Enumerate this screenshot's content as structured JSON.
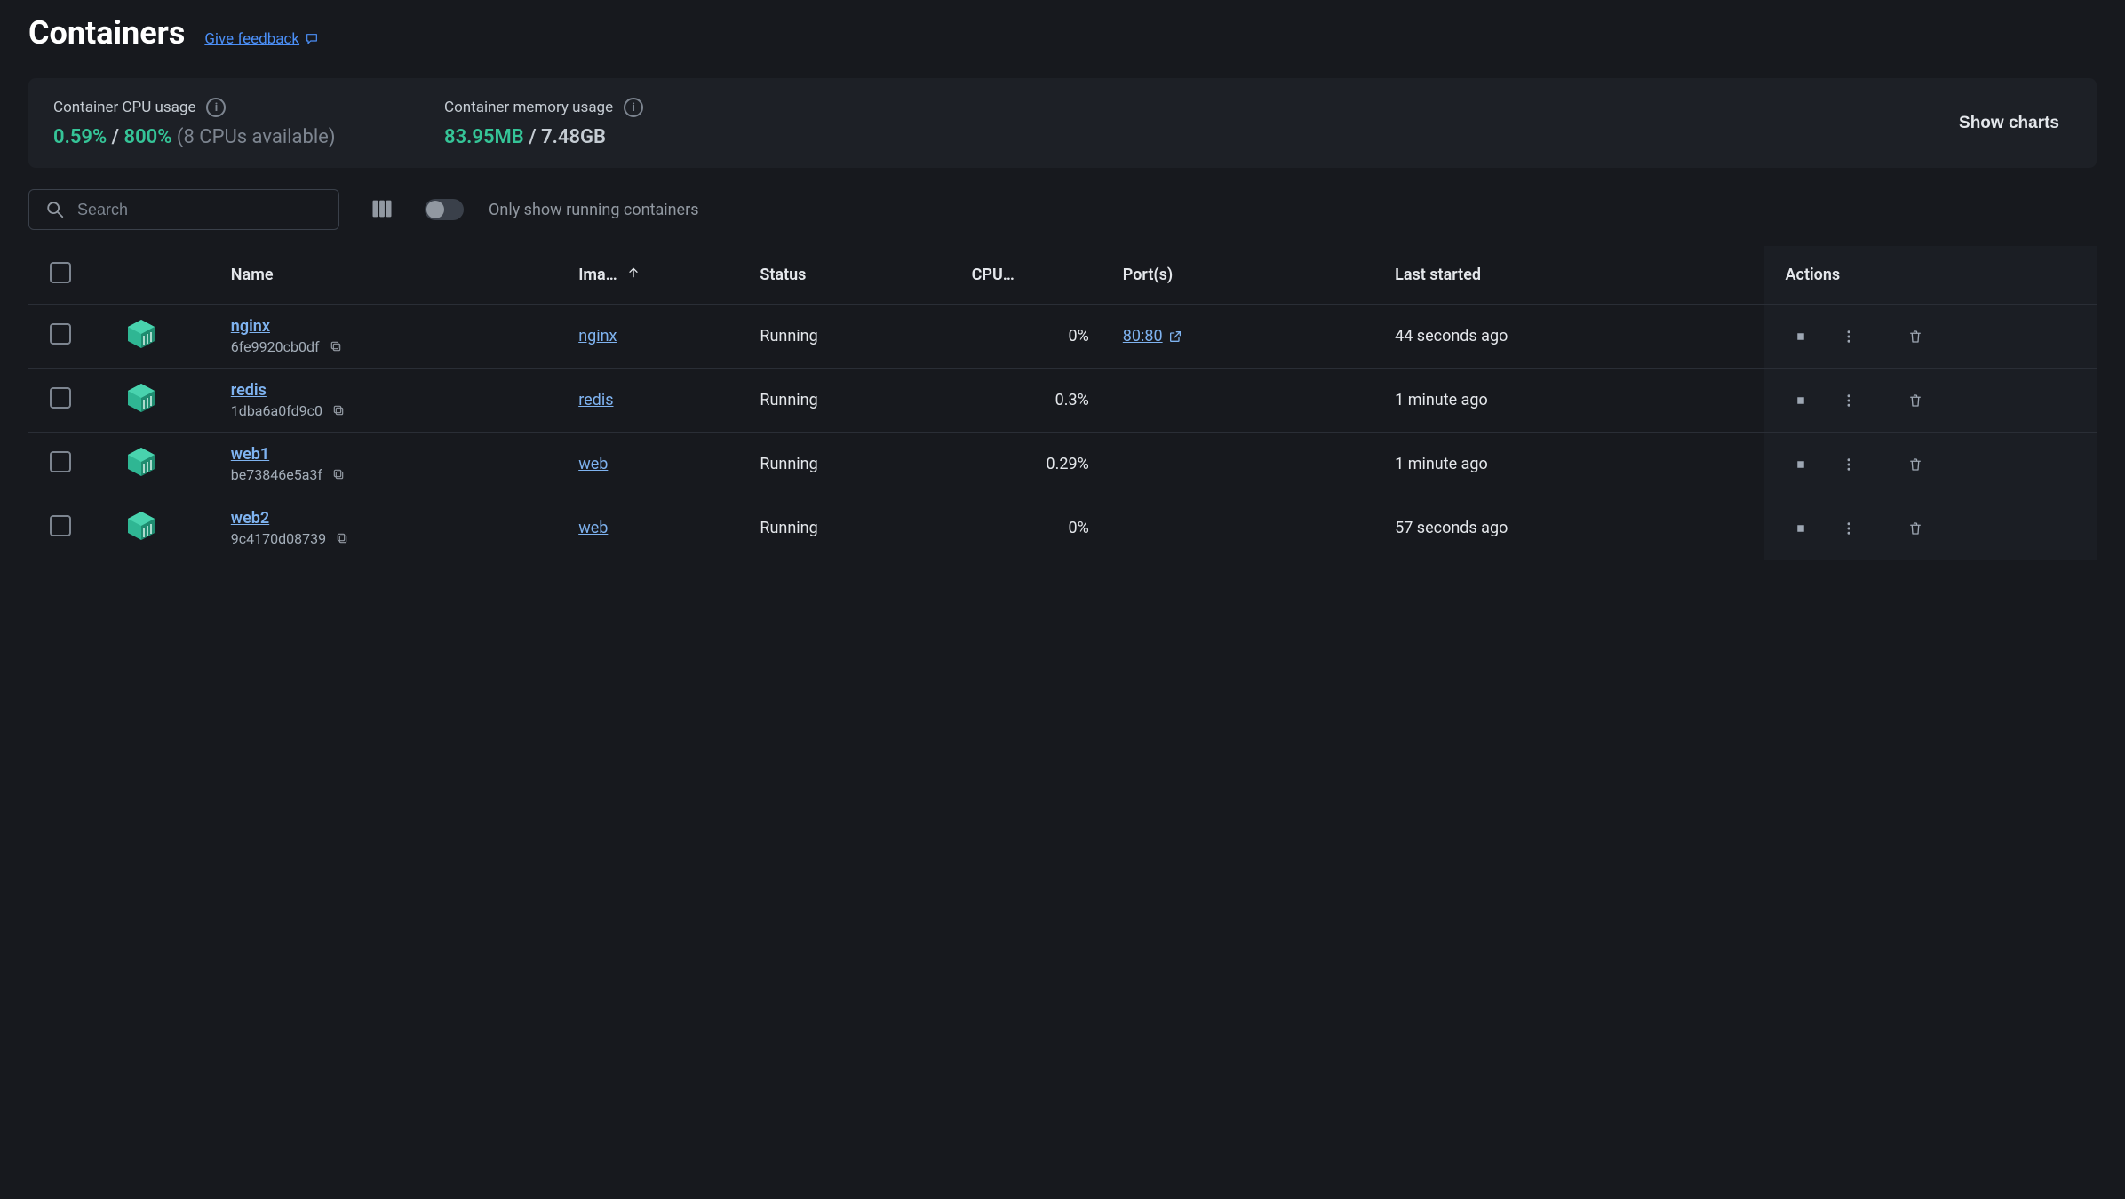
{
  "header": {
    "title": "Containers",
    "feedback_label": "Give feedback"
  },
  "usage": {
    "cpu_label": "Container CPU usage",
    "cpu_value": "0.59%",
    "cpu_sep": " / ",
    "cpu_total": "800%",
    "cpu_sub": "(8 CPUs available)",
    "mem_label": "Container memory usage",
    "mem_value": "83.95MB",
    "mem_sep": " / ",
    "mem_total": "7.48GB",
    "show_charts_label": "Show charts"
  },
  "controls": {
    "search_placeholder": "Search",
    "toggle_label": "Only show running containers"
  },
  "columns": {
    "name": "Name",
    "image": "Ima…",
    "status": "Status",
    "cpu": "CPU…",
    "ports": "Port(s)",
    "last_started": "Last started",
    "actions": "Actions"
  },
  "rows": [
    {
      "name": "nginx",
      "id": "6fe9920cb0df",
      "image": "nginx",
      "status": "Running",
      "cpu": "0%",
      "port": "80:80",
      "has_port": true,
      "last_started": "44 seconds ago"
    },
    {
      "name": "redis",
      "id": "1dba6a0fd9c0",
      "image": "redis",
      "status": "Running",
      "cpu": "0.3%",
      "port": "",
      "has_port": false,
      "last_started": "1 minute ago"
    },
    {
      "name": "web1",
      "id": "be73846e5a3f",
      "image": "web",
      "status": "Running",
      "cpu": "0.29%",
      "port": "",
      "has_port": false,
      "last_started": "1 minute ago"
    },
    {
      "name": "web2",
      "id": "9c4170d08739",
      "image": "web",
      "status": "Running",
      "cpu": "0%",
      "port": "",
      "has_port": false,
      "last_started": "57 seconds ago"
    }
  ]
}
